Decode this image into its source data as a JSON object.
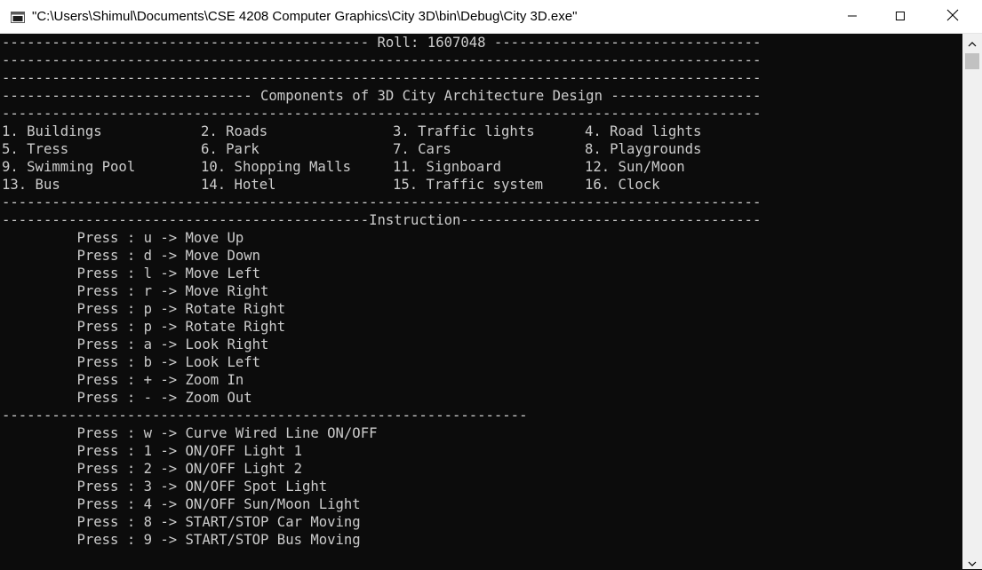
{
  "window": {
    "title": "\"C:\\Users\\Shimul\\Documents\\CSE 4208 Computer Graphics\\City 3D\\bin\\Debug\\City 3D.exe\""
  },
  "console": {
    "lines": [
      {
        "text": "-------------------------------------------- Roll: 1607048 --------------------------------"
      },
      {
        "text": "-------------------------------------------------------------------------------------------"
      },
      {
        "text": "-------------------------------------------------------------------------------------------"
      },
      {
        "text": "------------------------------ Components of 3D City Architecture Design ------------------"
      },
      {
        "text": "-------------------------------------------------------------------------------------------"
      },
      {
        "cells": [
          "1. Buildings",
          "2. Roads",
          "3. Traffic lights",
          "4. Road lights"
        ]
      },
      {
        "cells": [
          "5. Tress",
          "6. Park",
          "7. Cars",
          "8. Playgrounds"
        ]
      },
      {
        "cells": [
          "9. Swimming Pool",
          "10. Shopping Malls",
          "11. Signboard",
          "12. Sun/Moon"
        ]
      },
      {
        "cells": [
          "13. Bus",
          "14. Hotel",
          "15. Traffic system",
          "16. Clock"
        ]
      },
      {
        "text": "-------------------------------------------------------------------------------------------"
      },
      {
        "text": "--------------------------------------------Instruction------------------------------------"
      },
      {
        "text": "         Press : u -> Move Up"
      },
      {
        "text": "         Press : d -> Move Down"
      },
      {
        "text": "         Press : l -> Move Left"
      },
      {
        "text": "         Press : r -> Move Right"
      },
      {
        "text": "         Press : p -> Rotate Right"
      },
      {
        "text": "         Press : p -> Rotate Right"
      },
      {
        "text": "         Press : a -> Look Right"
      },
      {
        "text": "         Press : b -> Look Left"
      },
      {
        "text": "         Press : + -> Zoom In"
      },
      {
        "text": "         Press : - -> Zoom Out"
      },
      {
        "text": "---------------------------------------------------------------"
      },
      {
        "text": "         Press : w -> Curve Wired Line ON/OFF"
      },
      {
        "text": "         Press : 1 -> ON/OFF Light 1"
      },
      {
        "text": "         Press : 2 -> ON/OFF Light 2"
      },
      {
        "text": "         Press : 3 -> ON/OFF Spot Light"
      },
      {
        "text": "         Press : 4 -> ON/OFF Sun/Moon Light"
      },
      {
        "text": "         Press : 8 -> START/STOP Car Moving"
      },
      {
        "text": "         Press : 9 -> START/STOP Bus Moving"
      }
    ]
  },
  "icons": {
    "app": "console-app-icon",
    "minimize": "minimize-icon",
    "maximize": "maximize-icon",
    "close": "close-icon",
    "scroll_up": "scroll-up-arrow-icon",
    "scroll_down": "scroll-down-arrow-icon"
  },
  "colors": {
    "console_bg": "#0c0c0c",
    "console_text": "#cccccc",
    "titlebar_bg": "#ffffff"
  }
}
